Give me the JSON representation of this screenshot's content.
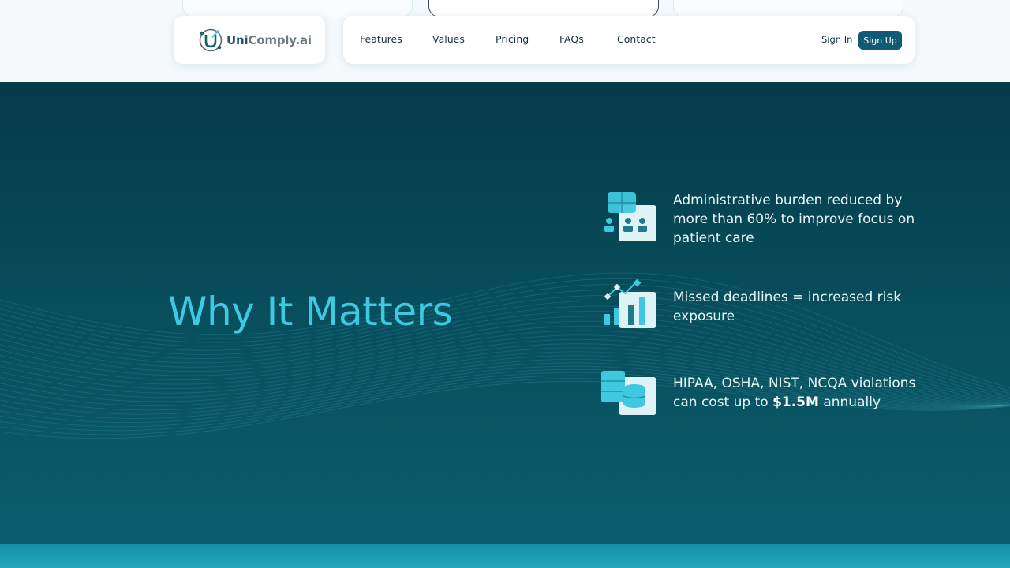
{
  "header": {
    "logo": {
      "brand_primary": "Uni",
      "brand_secondary": "Comply.ai"
    },
    "nav": [
      {
        "label": "Features"
      },
      {
        "label": "Values"
      },
      {
        "label": "Pricing"
      },
      {
        "label": "FAQs"
      },
      {
        "label": "Contact"
      }
    ],
    "signin_label": "Sign In",
    "signup_label": "Sign Up"
  },
  "hero": {
    "title": "Why It Matters",
    "features": [
      {
        "icon": "team-icon",
        "text": "Administrative burden reduced by more than 60% to improve focus on patient care"
      },
      {
        "icon": "growth-chart-icon",
        "text": "Missed deadlines = increased risk exposure"
      },
      {
        "icon": "database-icon",
        "text_before": "HIPAA, OSHA, NIST, NCQA violations can cost up to ",
        "text_bold": "$1.5M",
        "text_after": " annually"
      }
    ]
  },
  "colors": {
    "brand": "#0f5a74",
    "accent": "#3ec9e0",
    "hero_bg": "#08505f"
  }
}
